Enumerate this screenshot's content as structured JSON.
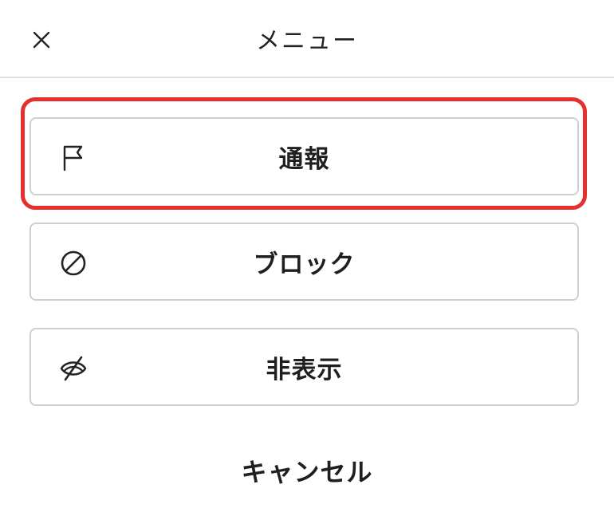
{
  "header": {
    "title": "メニュー",
    "close_icon": "close-icon"
  },
  "menu": {
    "items": [
      {
        "label": "通報",
        "icon": "flag-icon",
        "highlighted": true
      },
      {
        "label": "ブロック",
        "icon": "block-icon",
        "highlighted": false
      },
      {
        "label": "非表示",
        "icon": "eye-off-icon",
        "highlighted": false
      }
    ]
  },
  "cancel": {
    "label": "キャンセル"
  },
  "colors": {
    "highlight": "#e53030",
    "border": "#cfcfcf",
    "divider": "#e1e1e1",
    "text": "#1f1f1f"
  }
}
